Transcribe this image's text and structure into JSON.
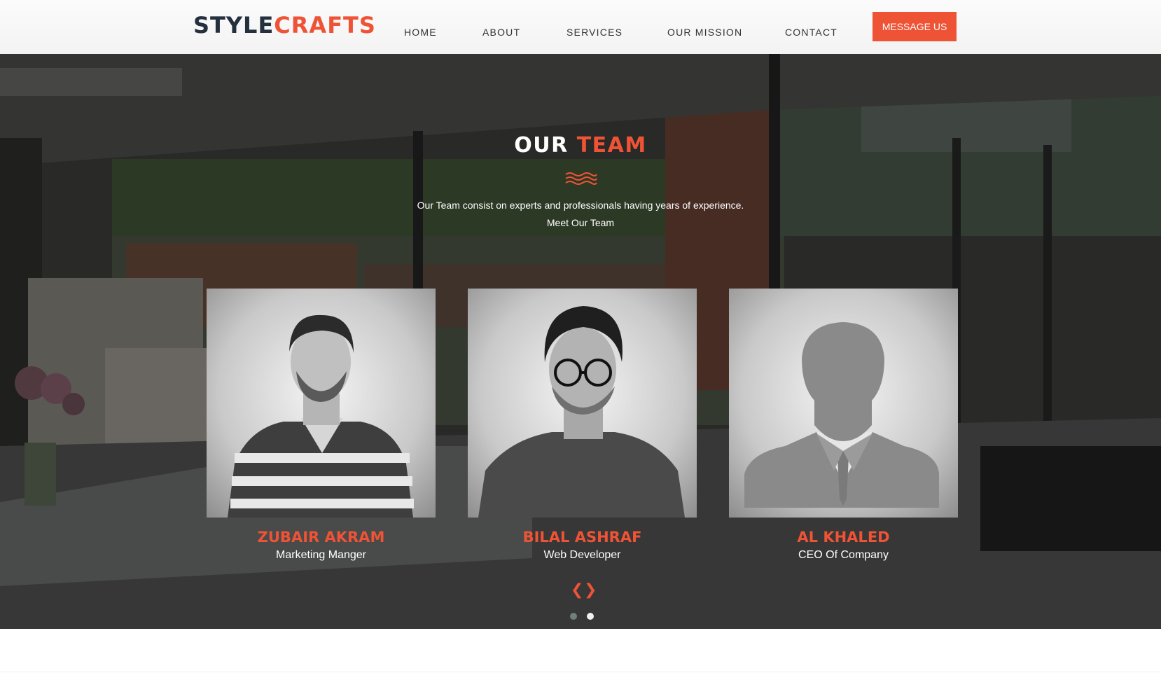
{
  "header": {
    "logo_part1": "STYLE",
    "logo_part2": "CRAFTS",
    "nav": [
      "HOME",
      "ABOUT",
      "SERVICES",
      "OUR MISSION",
      "CONTACT"
    ],
    "cta_label": "MESSAGE US"
  },
  "team": {
    "title_part1": "OUR",
    "title_part2": "TEAM",
    "intro_line1": "Our Team consist on experts and professionals having years of experience.",
    "intro_line2": "Meet Our Team",
    "members": [
      {
        "name": "ZUBAIR AKRAM",
        "role": "Marketing Manger"
      },
      {
        "name": "BILAL ASHRAF",
        "role": "Web Developer"
      },
      {
        "name": "AL KHALED",
        "role": "CEO Of Company"
      }
    ],
    "prev_icon": "chevron-left-icon",
    "next_icon": "chevron-right-icon"
  },
  "carousel": {
    "slides": 2,
    "active": 2
  },
  "colors": {
    "accent": "#ef5336",
    "dark": "#25303f",
    "nav_text": "#333333"
  }
}
